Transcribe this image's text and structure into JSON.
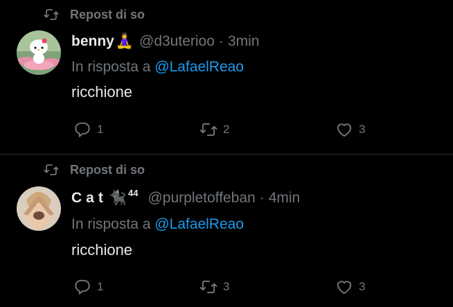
{
  "tweets": [
    {
      "repost_label": "Repost di so",
      "author_name": "benny",
      "author_emoji": "🧘‍♀️",
      "author_suffix": "",
      "handle": "@d3uterioo",
      "separator": "·",
      "time": "3min",
      "reply_prefix": "In risposta a",
      "reply_mention": "@LafaelReao",
      "text": "ricchione",
      "replies": "1",
      "reposts": "2",
      "likes": "3"
    },
    {
      "repost_label": "Repost di so",
      "author_name": "Cat",
      "author_emoji": "🐈‍⬛",
      "author_suffix": "44",
      "handle": "@purpletoffeban",
      "separator": "·",
      "time": "4min",
      "reply_prefix": "In risposta a",
      "reply_mention": "@LafaelReao",
      "text": "ricchione",
      "replies": "1",
      "reposts": "3",
      "likes": "3"
    }
  ],
  "colors": {
    "background": "#000000",
    "text": "#e7e9ea",
    "muted": "#71767b",
    "mention": "#1d9bf0",
    "divider": "#2f3336"
  },
  "icons": [
    "repost-icon",
    "reply-icon",
    "like-icon"
  ]
}
